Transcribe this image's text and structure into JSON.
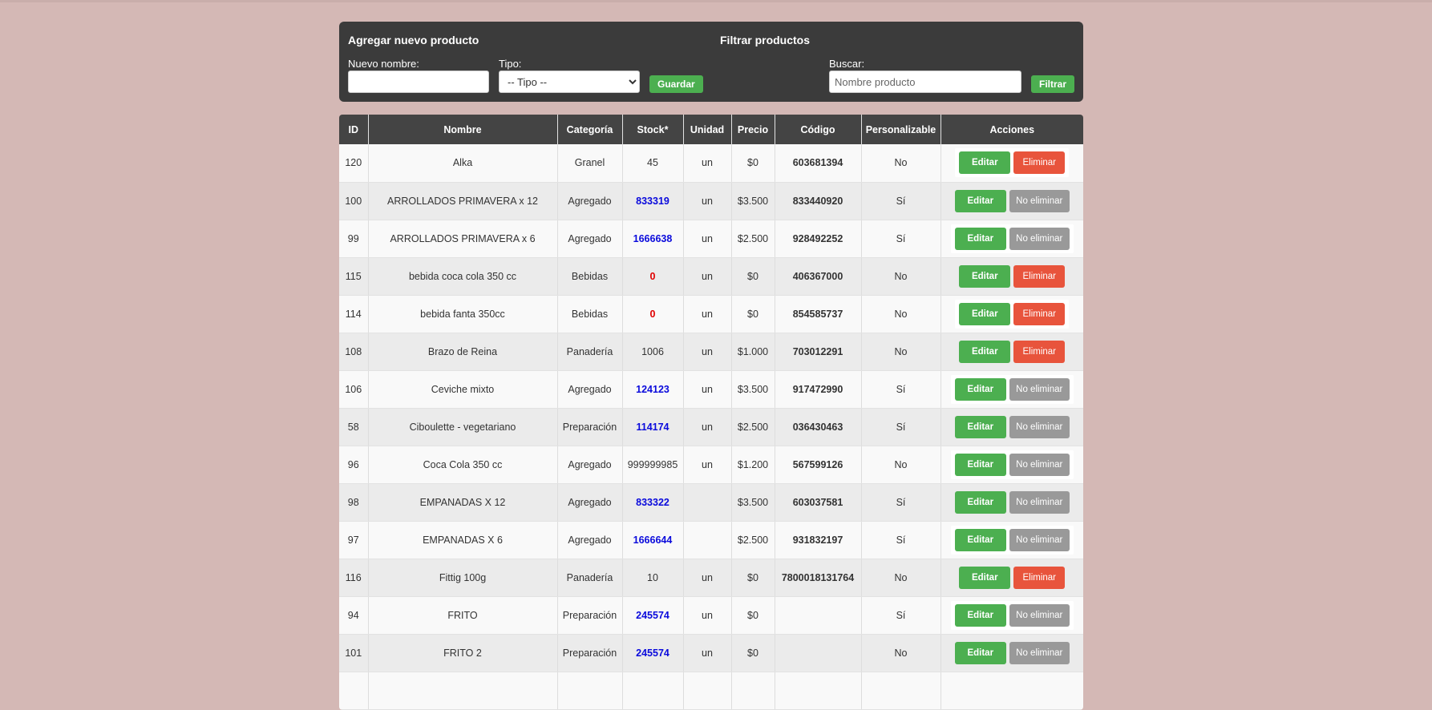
{
  "add_panel": {
    "title": "Agregar nuevo producto",
    "name_label": "Nuevo nombre:",
    "name_value": "",
    "type_label": "Tipo:",
    "type_selected": "-- Tipo --",
    "save_label": "Guardar"
  },
  "filter_panel": {
    "title": "Filtrar productos",
    "search_label": "Buscar:",
    "search_placeholder": "Nombre producto",
    "filter_label": "Filtrar"
  },
  "table": {
    "headers": [
      "ID",
      "Nombre",
      "Categoría",
      "Stock*",
      "Unidad",
      "Precio",
      "Código",
      "Personalizable",
      "Acciones"
    ],
    "rows": [
      {
        "id": "120",
        "name": "Alka",
        "category": "Granel",
        "stock": "45",
        "stock_style": "plain",
        "unit": "un",
        "price": "$0",
        "code": "603681394",
        "custom": "No",
        "edit": "Editar",
        "delete": "Eliminar",
        "deletable": true
      },
      {
        "id": "100",
        "name": "ARROLLADOS PRIMAVERA x 12",
        "category": "Agregado",
        "stock": "833319",
        "stock_style": "blue",
        "unit": "un",
        "price": "$3.500",
        "code": "833440920",
        "custom": "Sí",
        "edit": "Editar",
        "delete": "No eliminar",
        "deletable": false
      },
      {
        "id": "99",
        "name": "ARROLLADOS PRIMAVERA x 6",
        "category": "Agregado",
        "stock": "1666638",
        "stock_style": "blue",
        "unit": "un",
        "price": "$2.500",
        "code": "928492252",
        "custom": "Sí",
        "edit": "Editar",
        "delete": "No eliminar",
        "deletable": false
      },
      {
        "id": "115",
        "name": "bebida coca cola 350 cc",
        "category": "Bebidas",
        "stock": "0",
        "stock_style": "red",
        "unit": "un",
        "price": "$0",
        "code": "406367000",
        "custom": "No",
        "edit": "Editar",
        "delete": "Eliminar",
        "deletable": true
      },
      {
        "id": "114",
        "name": "bebida fanta 350cc",
        "category": "Bebidas",
        "stock": "0",
        "stock_style": "red",
        "unit": "un",
        "price": "$0",
        "code": "854585737",
        "custom": "No",
        "edit": "Editar",
        "delete": "Eliminar",
        "deletable": true
      },
      {
        "id": "108",
        "name": "Brazo de Reina",
        "category": "Panadería",
        "stock": "1006",
        "stock_style": "plain",
        "unit": "un",
        "price": "$1.000",
        "code": "703012291",
        "custom": "No",
        "edit": "Editar",
        "delete": "Eliminar",
        "deletable": true
      },
      {
        "id": "106",
        "name": "Ceviche mixto",
        "category": "Agregado",
        "stock": "124123",
        "stock_style": "blue",
        "unit": "un",
        "price": "$3.500",
        "code": "917472990",
        "custom": "Sí",
        "edit": "Editar",
        "delete": "No eliminar",
        "deletable": false
      },
      {
        "id": "58",
        "name": "Ciboulette - vegetariano",
        "category": "Preparación",
        "stock": "114174",
        "stock_style": "blue",
        "unit": "un",
        "price": "$2.500",
        "code": "036430463",
        "custom": "Sí",
        "edit": "Editar",
        "delete": "No eliminar",
        "deletable": false
      },
      {
        "id": "96",
        "name": "Coca Cola 350 cc",
        "category": "Agregado",
        "stock": "999999985",
        "stock_style": "plain",
        "unit": "un",
        "price": "$1.200",
        "code": "567599126",
        "custom": "No",
        "edit": "Editar",
        "delete": "No eliminar",
        "deletable": false
      },
      {
        "id": "98",
        "name": "EMPANADAS X 12",
        "category": "Agregado",
        "stock": "833322",
        "stock_style": "blue",
        "unit": "",
        "price": "$3.500",
        "code": "603037581",
        "custom": "Sí",
        "edit": "Editar",
        "delete": "No eliminar",
        "deletable": false
      },
      {
        "id": "97",
        "name": "EMPANADAS X 6",
        "category": "Agregado",
        "stock": "1666644",
        "stock_style": "blue",
        "unit": "",
        "price": "$2.500",
        "code": "931832197",
        "custom": "Sí",
        "edit": "Editar",
        "delete": "No eliminar",
        "deletable": false
      },
      {
        "id": "116",
        "name": "Fittig 100g",
        "category": "Panadería",
        "stock": "10",
        "stock_style": "plain",
        "unit": "un",
        "price": "$0",
        "code": "7800018131764",
        "custom": "No",
        "edit": "Editar",
        "delete": "Eliminar",
        "deletable": true
      },
      {
        "id": "94",
        "name": "FRITO",
        "category": "Preparación",
        "stock": "245574",
        "stock_style": "blue",
        "unit": "un",
        "price": "$0",
        "code": "",
        "custom": "Sí",
        "edit": "Editar",
        "delete": "No eliminar",
        "deletable": false
      },
      {
        "id": "101",
        "name": "FRITO 2",
        "category": "Preparación",
        "stock": "245574",
        "stock_style": "blue",
        "unit": "un",
        "price": "$0",
        "code": "",
        "custom": "No",
        "edit": "Editar",
        "delete": "No eliminar",
        "deletable": false
      },
      {
        "id": "",
        "name": "",
        "category": "",
        "stock": "",
        "stock_style": "plain",
        "unit": "",
        "price": "",
        "code": "",
        "custom": "",
        "edit": "",
        "delete": "",
        "deletable": false
      }
    ]
  },
  "colors": {
    "page_bg": "#d4b8b5",
    "panel_bg": "#3b3b3b",
    "green": "#4caf50",
    "red": "#e8543c",
    "gray": "#999999",
    "stock_blue": "#0a0adc",
    "stock_red": "#e00000"
  }
}
